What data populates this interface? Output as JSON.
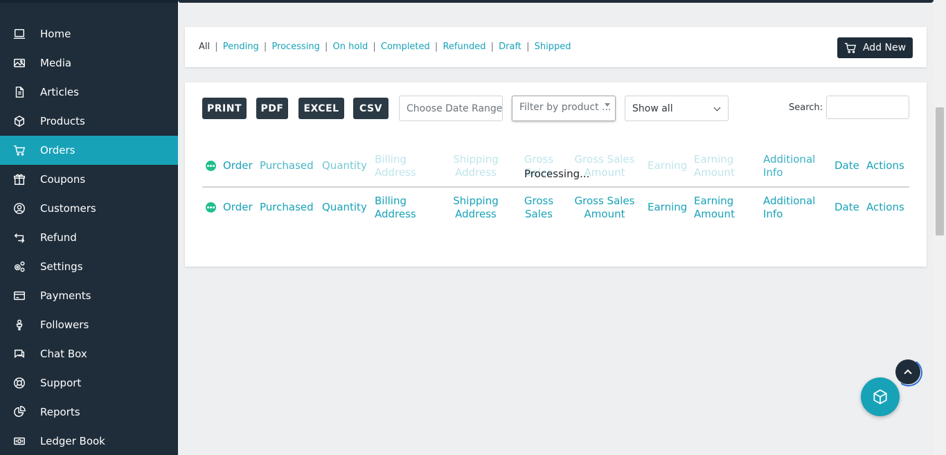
{
  "sidebar": {
    "items": [
      {
        "label": "Home",
        "icon": "laptop-icon",
        "active": false
      },
      {
        "label": "Media",
        "icon": "image-icon",
        "active": false
      },
      {
        "label": "Articles",
        "icon": "document-icon",
        "active": false
      },
      {
        "label": "Products",
        "icon": "box-icon",
        "active": false
      },
      {
        "label": "Orders",
        "icon": "cart-icon",
        "active": true
      },
      {
        "label": "Coupons",
        "icon": "gift-icon",
        "active": false
      },
      {
        "label": "Customers",
        "icon": "user-circle-icon",
        "active": false
      },
      {
        "label": "Refund",
        "icon": "refund-icon",
        "active": false
      },
      {
        "label": "Settings",
        "icon": "gears-icon",
        "active": false
      },
      {
        "label": "Payments",
        "icon": "credit-card-icon",
        "active": false
      },
      {
        "label": "Followers",
        "icon": "followers-icon",
        "active": false
      },
      {
        "label": "Chat Box",
        "icon": "chat-icon",
        "active": false
      },
      {
        "label": "Support",
        "icon": "lifebuoy-icon",
        "active": false
      },
      {
        "label": "Reports",
        "icon": "pie-chart-icon",
        "active": false
      },
      {
        "label": "Ledger Book",
        "icon": "money-icon",
        "active": false
      }
    ]
  },
  "status_filter": {
    "all": "All",
    "links": [
      "Pending",
      "Processing",
      "On hold",
      "Completed",
      "Refunded",
      "Draft",
      "Shipped"
    ],
    "separator": "|"
  },
  "add_new_label": "Add New",
  "toolbar": {
    "print": "PRINT",
    "pdf": "PDF",
    "excel": "EXCEL",
    "csv": "CSV",
    "date_range_placeholder": "Choose Date Range ...",
    "product_filter_placeholder": "Filter by product ...",
    "show_all": "Show all",
    "search_label": "Search:"
  },
  "table": {
    "columns": [
      "Order",
      "Purchased",
      "Quantity",
      "Billing Address",
      "Shipping Address",
      "Gross Sales",
      "Gross Sales Amount",
      "Earning",
      "Earning Amount",
      "Additional Info",
      "Date",
      "Actions"
    ],
    "processing_text": "Processing..."
  },
  "colors": {
    "sidebar_bg": "#1f2d3a",
    "accent": "#17a2b8",
    "page_bg": "#eeeff1"
  }
}
